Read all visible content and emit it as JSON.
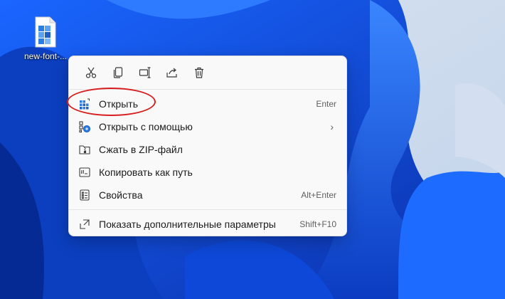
{
  "desktop": {
    "file_label": "new-font-..."
  },
  "toolbar": {
    "cut_icon": "scissors-icon",
    "copy_icon": "copy-icon",
    "rename_icon": "rename-icon",
    "share_icon": "share-icon",
    "delete_icon": "trash-icon"
  },
  "menu": {
    "items": [
      {
        "label": "Открыть",
        "shortcut": "Enter",
        "icon": "app-grid-icon"
      },
      {
        "label": "Открыть с помощью",
        "shortcut": "",
        "icon": "open-with-icon",
        "submenu": true
      },
      {
        "label": "Сжать в ZIP-файл",
        "shortcut": "",
        "icon": "zip-folder-icon"
      },
      {
        "label": "Копировать как путь",
        "shortcut": "",
        "icon": "copy-path-icon"
      },
      {
        "label": "Свойства",
        "shortcut": "Alt+Enter",
        "icon": "properties-icon"
      },
      {
        "label": "Показать дополнительные параметры",
        "shortcut": "Shift+F10",
        "icon": "more-options-icon"
      }
    ],
    "submenu_glyph": "›"
  },
  "colors": {
    "accent": "#0067c0",
    "highlight_ring": "#d81e1e",
    "wallpaper_blue": "#0a4fd6"
  }
}
